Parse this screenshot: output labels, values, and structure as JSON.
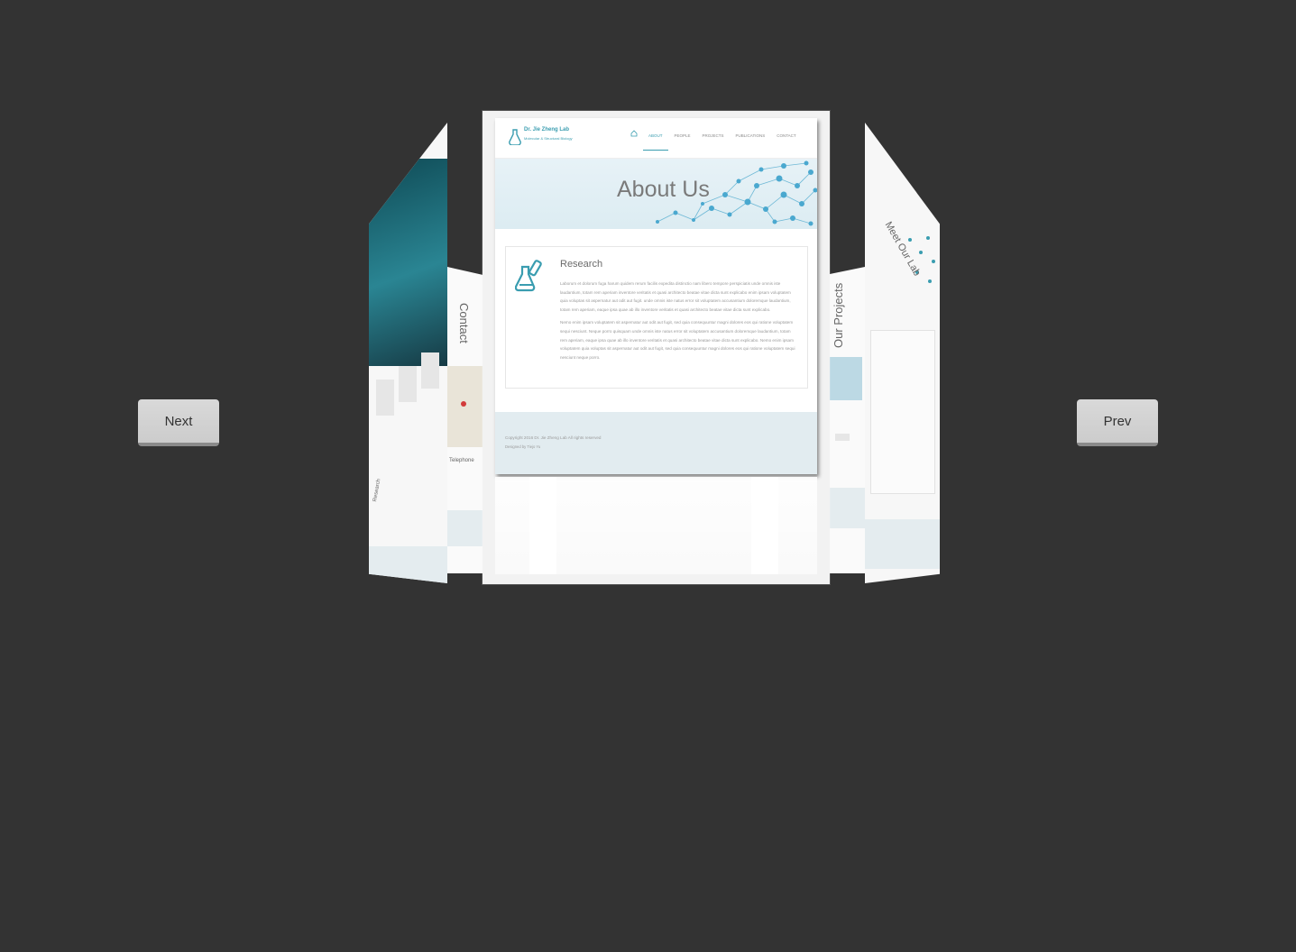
{
  "controls": {
    "next_label": "Next",
    "prev_label": "Prev"
  },
  "center_slide": {
    "lab_name": "Dr. Jie Zheng Lab",
    "lab_subtitle": "Molecular & Structural Biology",
    "nav": [
      "ABOUT",
      "PEOPLE",
      "PROJECTS",
      "PUBLICATIONS",
      "CONTACT"
    ],
    "active_nav": "ABOUT",
    "hero_title": "About Us",
    "card_title": "Research",
    "card_paragraph_1": "Laborum et dolorum fuga harum quidem rerum facilis expedita distinctio nam libero tempore perspiciatis unde omnis iste laudantium, totam rem aperiam inventore veritatis et quasi architecto beatae vitae dicta sunt explicabo enim ipsam voluptatem quia voluptas sit aspernatur aut odit aut fugit. unde omnis iste natus error sit voluptatem accusantium doloremque laudantium, totam rem aperiam, eaque ipsa quae ab illo inventore veritatis et quasi architecto beatae vitae dicta sunt explicabo.",
    "card_paragraph_2": "Nemo enim ipsam voluptatem sit aspernatur aut odit aut fugit, sed quia consequuntur magni dolores eos qui ratione voluptatem sequi nesciunt. Neque porro quisquam unde omnis iste natus error sit voluptatem accusantium doloremque laudantium, totam rem aperiam, eaque ipsa quae ab illo inventore veritatis et quasi architecto beatae vitae dicta sunt explicabo. Nemo enim ipsam voluptatem quia voluptas sit aspernatur aut odit aut fugit, sed quia consequuntur magni dolores eos qui ratione voluptatem sequi nesciunt neque porro.",
    "copyright": "Copyright 2016 Dr. Jie Zheng Lab All rights reserved",
    "designer": "Designed by Tiejo Yu"
  },
  "side_slides": {
    "mid_left_title": "Contact",
    "mid_left_caption": "Telephone",
    "mid_right_title": "Our Projects",
    "far_right_title": "Meet Our Lab",
    "far_left_heading": "Research"
  },
  "colors": {
    "background": "#333333",
    "accent": "#3a9db0"
  }
}
